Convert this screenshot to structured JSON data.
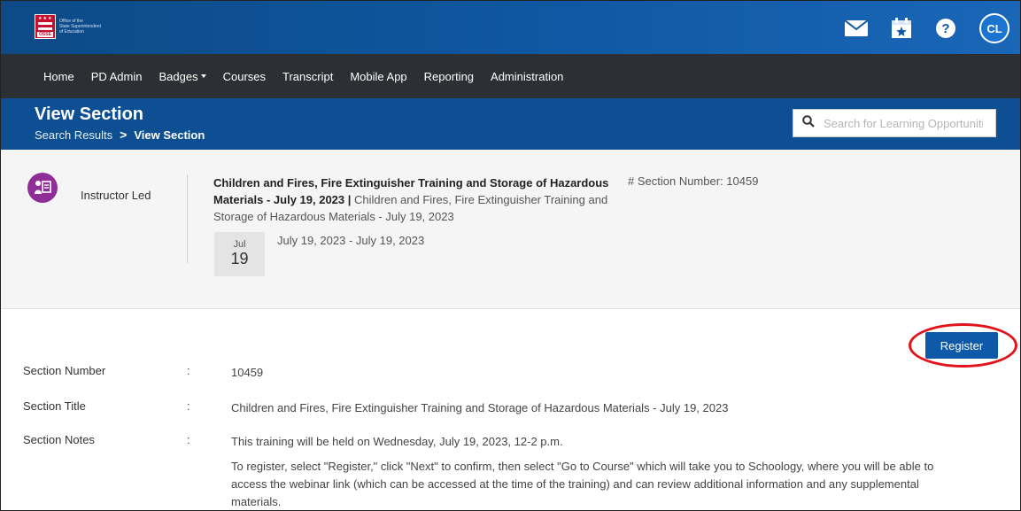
{
  "brand": {
    "logo_tag": "OSSE",
    "logo_lines": [
      "Office of the",
      "State Superintendent",
      "of Education"
    ]
  },
  "header_icons": [
    {
      "name": "mail-icon"
    },
    {
      "name": "calendar-star-icon"
    },
    {
      "name": "help-icon"
    }
  ],
  "user": {
    "initials": "CL"
  },
  "nav": {
    "items": [
      {
        "label": "Home",
        "dropdown": false
      },
      {
        "label": "PD Admin",
        "dropdown": false
      },
      {
        "label": "Badges",
        "dropdown": true
      },
      {
        "label": "Courses",
        "dropdown": false
      },
      {
        "label": "Transcript",
        "dropdown": false
      },
      {
        "label": "Mobile App",
        "dropdown": false
      },
      {
        "label": "Reporting",
        "dropdown": false
      },
      {
        "label": "Administration",
        "dropdown": false
      }
    ]
  },
  "page": {
    "title": "View Section",
    "breadcrumb": {
      "parent": "Search Results",
      "separator": ">",
      "current": "View Section"
    },
    "search_placeholder": "Search for Learning Opportunities"
  },
  "summary": {
    "type_label": "Instructor Led",
    "title_bold": "Children and Fires, Fire Extinguisher Training and Storage of Hazardous Materials - July 19, 2023",
    "title_sep": " | ",
    "title_rest": "Children and Fires, Fire Extinguisher Training and Storage of Hazardous Materials - July 19, 2023",
    "section_number_label": "# Section Number: 10459",
    "date_month": "Jul",
    "date_day": "19",
    "date_range": "July 19, 2023 - July 19, 2023"
  },
  "register_label": "Register",
  "details": {
    "section_number": {
      "label": "Section Number",
      "colon": ":",
      "value": "10459"
    },
    "section_title": {
      "label": "Section Title",
      "colon": ":",
      "value": "Children and Fires, Fire Extinguisher Training and Storage of Hazardous Materials - July 19, 2023"
    },
    "section_notes": {
      "label": "Section Notes",
      "colon": ":",
      "line1": "This training will be held on Wednesday, July 19, 2023, 12-2 p.m.",
      "line2": "To register, select \"Register,\" click \"Next\" to confirm, then select \"Go to Course\" which will take you to Schoology, where you will be able to access the webinar link (which can be accessed at the time of the training) and can review additional information and any supplemental materials."
    }
  },
  "colors": {
    "brand_blue": "#0f58a3",
    "nav_dark": "#2c2f33",
    "header_blue": "#0d4f92",
    "register_blue": "#0f5aa8",
    "highlight_red": "#e0141a",
    "instructor_purple": "#8e2e96"
  }
}
